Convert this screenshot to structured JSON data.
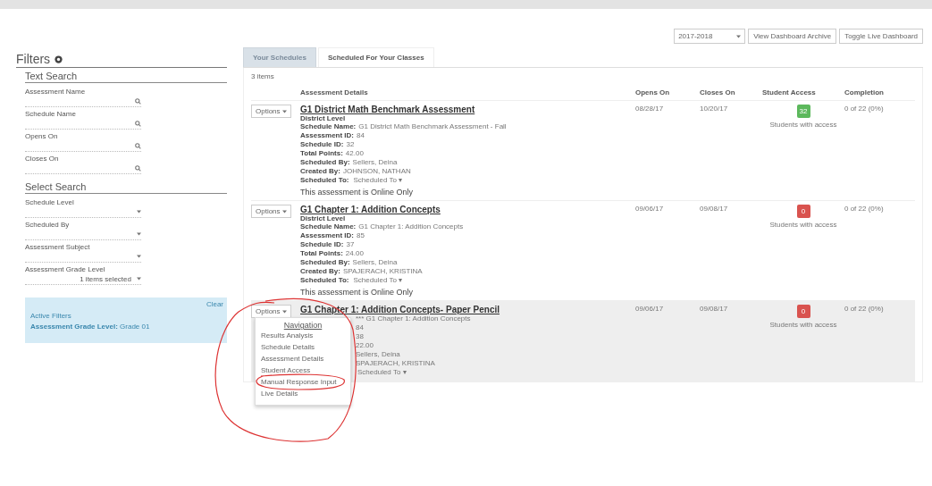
{
  "top_controls": {
    "year_select": "2017-2018",
    "buttons": [
      "View Dashboard Archive",
      "Toggle Live Dashboard"
    ]
  },
  "filters": {
    "title": "Filters",
    "text_search": {
      "heading": "Text Search",
      "fields": [
        {
          "label": "Assessment Name"
        },
        {
          "label": "Schedule Name"
        },
        {
          "label": "Opens On"
        },
        {
          "label": "Closes On"
        }
      ]
    },
    "select_search": {
      "heading": "Select Search",
      "fields": [
        {
          "label": "Schedule Level"
        },
        {
          "label": "Scheduled By"
        },
        {
          "label": "Assessment Subject"
        },
        {
          "label": "Assessment Grade Level",
          "value": "1 items selected"
        }
      ]
    },
    "active_filters": {
      "title": "Active Filters",
      "clear": "Clear",
      "items": [
        {
          "label": "Assessment Grade Level:",
          "value": "Grade 01"
        }
      ]
    }
  },
  "tabs": [
    {
      "label": "Your Schedules",
      "selected": true
    },
    {
      "label": "Scheduled For Your Classes",
      "selected": false
    }
  ],
  "item_count": "3 items",
  "table": {
    "columns": [
      "Assessment Details",
      "Opens On",
      "Closes On",
      "Student Access",
      "Completion"
    ],
    "rows": [
      {
        "options": "Options",
        "highlighted": false,
        "title": "G1 District Math Benchmark Assessment",
        "level": "District Level",
        "fields": [
          {
            "label": "Schedule Name:",
            "value": "G1 District Math Benchmark Assessment - Fall",
            "kind": "text"
          },
          {
            "label": "Assessment ID:",
            "value": "84",
            "kind": "text"
          },
          {
            "label": "Schedule ID:",
            "value": "32",
            "kind": "text"
          },
          {
            "label": "Total Points:",
            "value": "42.00",
            "kind": "text"
          },
          {
            "label": "Scheduled By:",
            "value": "Sellers, Deina",
            "kind": "text"
          },
          {
            "label": "Created By:",
            "value": "JOHNSON, NATHAN",
            "kind": "text"
          },
          {
            "label": "Scheduled To:",
            "value": "Scheduled To ▾",
            "kind": "dropdown"
          }
        ],
        "note": "This assessment is Online Only",
        "opens": "08/28/17",
        "closes": "10/20/17",
        "access": {
          "count": "32",
          "color": "#5cb85c"
        },
        "access_label": "Students with access",
        "completion": "0 of 22 (0%)"
      },
      {
        "options": "Options",
        "highlighted": false,
        "title": "G1 Chapter 1: Addition Concepts",
        "level": "District Level",
        "fields": [
          {
            "label": "Schedule Name:",
            "value": "G1 Chapter 1: Addition Concepts",
            "kind": "text"
          },
          {
            "label": "Assessment ID:",
            "value": "85",
            "kind": "text"
          },
          {
            "label": "Schedule ID:",
            "value": "37",
            "kind": "text"
          },
          {
            "label": "Total Points:",
            "value": "24.00",
            "kind": "text"
          },
          {
            "label": "Scheduled By:",
            "value": "Sellers, Deina",
            "kind": "text"
          },
          {
            "label": "Created By:",
            "value": "SPAJERACH, KRISTINA",
            "kind": "text"
          },
          {
            "label": "Scheduled To:",
            "value": "Scheduled To ▾",
            "kind": "dropdown"
          }
        ],
        "note": "This assessment is Online Only",
        "opens": "09/06/17",
        "closes": "09/08/17",
        "access": {
          "count": "0",
          "color": "#d9534f"
        },
        "access_label": "Students with access",
        "completion": "0 of 22 (0%)"
      },
      {
        "options": "Options",
        "highlighted": true,
        "title": "G1 Chapter 1: Addition Concepts- Paper Pencil",
        "fields": [
          {
            "value": "*** G1 Chapter 1: Addition Concepts",
            "kind": "text"
          },
          {
            "value": "84",
            "kind": "text"
          },
          {
            "value": "38",
            "kind": "text"
          },
          {
            "value": "22.00",
            "kind": "text"
          },
          {
            "value": "Sellers, Deina",
            "kind": "text"
          },
          {
            "value": "SPAJERACH, KRISTINA",
            "kind": "text"
          },
          {
            "value": "Scheduled To ▾",
            "kind": "dropdown"
          }
        ],
        "opens": "09/06/17",
        "closes": "09/08/17",
        "access": {
          "count": "0",
          "color": "#d9534f"
        },
        "access_label": "Students with access",
        "completion": "0 of 22 (0%)",
        "menu": {
          "header": "Navigation",
          "items": [
            {
              "label": "Results Analysis",
              "circled": false
            },
            {
              "label": "Schedule Details",
              "circled": false
            },
            {
              "label": "Assessment Details",
              "circled": false
            },
            {
              "label": "Student Access",
              "circled": false
            },
            {
              "label": "Manual Response Input",
              "circled": true
            },
            {
              "label": "Live Details",
              "circled": false
            }
          ]
        }
      }
    ]
  }
}
